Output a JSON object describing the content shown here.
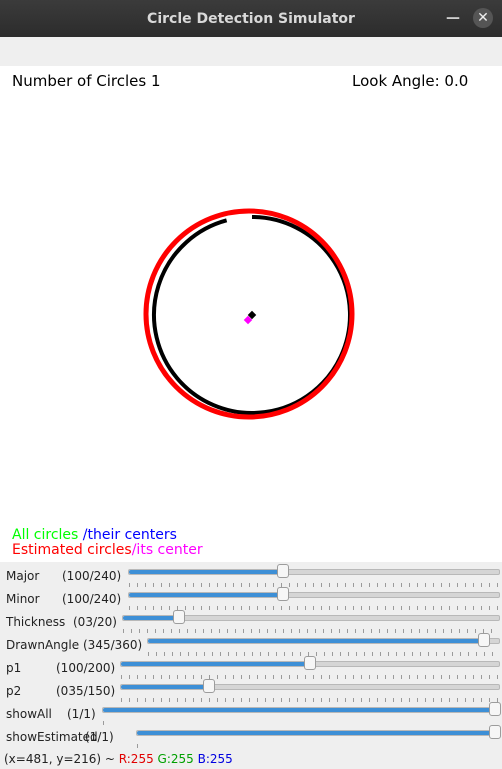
{
  "window": {
    "title": "Circle Detection Simulator"
  },
  "canvas": {
    "circle_count_label": "Number of Circles 1",
    "look_angle_label": "Look Angle: 0.0",
    "legend_line1_green": "All circles ",
    "legend_line1_blue": "/their centers",
    "legend_line2_red": "Estimated circles",
    "legend_line2_magenta": "/its center",
    "colors": {
      "green": "#00ff00",
      "blue": "#0000ff",
      "red": "#ff0000",
      "magenta": "#ff00ff",
      "black": "#000000"
    }
  },
  "sliders": [
    {
      "label": "Major",
      "value_text": "(100/240)",
      "value": 100,
      "max": 240
    },
    {
      "label": "Minor",
      "value_text": "(100/240)",
      "value": 100,
      "max": 240
    },
    {
      "label": "Thickness",
      "value_text": "(03/20)",
      "value": 3,
      "max": 20
    },
    {
      "label": "DrawnAngle",
      "value_text": "(345/360)",
      "value": 345,
      "max": 360
    },
    {
      "label": "p1",
      "value_text": "(100/200)",
      "value": 100,
      "max": 200
    },
    {
      "label": "p2",
      "value_text": "(035/150)",
      "value": 35,
      "max": 150
    },
    {
      "label": "showAll",
      "value_text": "(1/1)",
      "value": 1,
      "max": 1
    },
    {
      "label": "showEstimated",
      "value_text": "(1/1)",
      "value": 1,
      "max": 1
    }
  ],
  "status": {
    "coords": "(x=481, y=216) ~ ",
    "r": "R:255",
    "g": "G:255",
    "b": "B:255"
  }
}
